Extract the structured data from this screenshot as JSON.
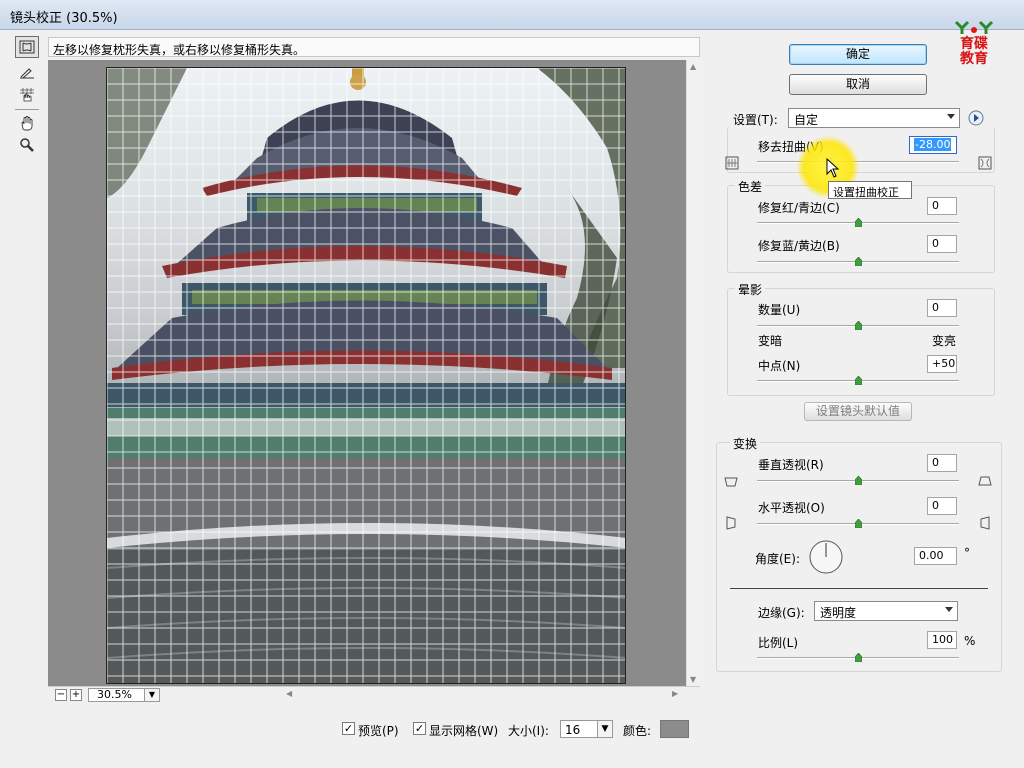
{
  "window": {
    "title": "镜头校正 (30.5%)"
  },
  "tools": [
    {
      "name": "remove-distortion-tool-icon"
    },
    {
      "name": "straighten-tool-icon"
    },
    {
      "name": "move-grid-tool-icon"
    },
    {
      "name": "hand-tool-icon"
    },
    {
      "name": "zoom-tool-icon"
    }
  ],
  "hint": "左移以修复枕形失真，或右移以修复桶形失真。",
  "preview": {
    "zoom": "30.5%",
    "grid_size": 16
  },
  "bottom": {
    "preview_label": "预览(P)",
    "show_grid_label": "显示网格(W)",
    "size_label": "大小(I):",
    "size_value": "16",
    "color_label": "颜色:",
    "grid_color": "#8c8c8c"
  },
  "buttons": {
    "ok": "确定",
    "cancel": "取消",
    "defaults": "设置镜头默认值"
  },
  "logo": {
    "line1": "育碟",
    "line2": "教育"
  },
  "settings": {
    "label": "设置(T):",
    "value": "自定"
  },
  "distortion": {
    "label": "移去扭曲(V)",
    "value": "-28.00",
    "slider": -28,
    "range": [
      -100,
      100
    ],
    "tooltip": "设置扭曲校正"
  },
  "chromatic": {
    "title": "色差",
    "red_cyan": {
      "label": "修复红/青边(C)",
      "value": "0",
      "slider": 0,
      "range": [
        -100,
        100
      ]
    },
    "blue_yellow": {
      "label": "修复蓝/黄边(B)",
      "value": "0",
      "slider": 0,
      "range": [
        -100,
        100
      ]
    }
  },
  "vignette": {
    "title": "晕影",
    "amount": {
      "label": "数量(U)",
      "value": "0",
      "slider": 0,
      "range": [
        -100,
        100
      ]
    },
    "darken": "变暗",
    "lighten": "变亮",
    "midpoint": {
      "label": "中点(N)",
      "value": "+50",
      "slider": 50,
      "range": [
        0,
        100
      ]
    }
  },
  "transform": {
    "title": "变换",
    "vertical": {
      "label": "垂直透视(R)",
      "value": "0",
      "slider": 0,
      "range": [
        -100,
        100
      ]
    },
    "horizontal": {
      "label": "水平透视(O)",
      "value": "0",
      "slider": 0,
      "range": [
        -100,
        100
      ]
    },
    "angle": {
      "label": "角度(E):",
      "value": "0.00",
      "unit": "°"
    },
    "edge": {
      "label": "边缘(G):",
      "value": "透明度"
    },
    "scale": {
      "label": "比例(L)",
      "value": "100",
      "unit": "%",
      "slider": 100,
      "range": [
        50,
        150
      ]
    }
  }
}
